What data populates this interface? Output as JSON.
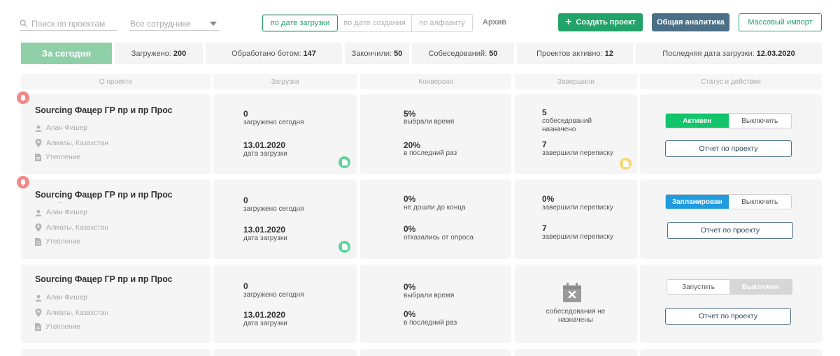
{
  "toolbar": {
    "search_placeholder": "Поиск по проектам",
    "employees_select": "Все сотрудники",
    "sort": [
      "по дате загрузки",
      "по дате создания",
      "по алфавиту"
    ],
    "archive": "Архив",
    "create": "Создать проект",
    "analytics": "Общая аналитика",
    "import": "Массовый импорт"
  },
  "stats": {
    "today": "За сегодня",
    "items": [
      {
        "label": "Загружено:",
        "value": "200"
      },
      {
        "label": "Обработано ботом:",
        "value": "147"
      },
      {
        "label": "Закончили:",
        "value": "50"
      },
      {
        "label": "Собеседований:",
        "value": "50"
      },
      {
        "label": "Проектов активно:",
        "value": "12"
      },
      {
        "label": "Последняя дата загрузки:",
        "value": "12.03.2020"
      }
    ]
  },
  "headers": [
    "О проекте",
    "Загрузки",
    "Конверсия",
    "Завершили",
    "Статус и действия"
  ],
  "rows": [
    {
      "title": "Sourcing Фацер ГР пр и пр Прос",
      "person": "Алан Фишер",
      "location": "Алматы, Казахстан",
      "type": "Утепление",
      "loaded_num": "0",
      "loaded_lbl": "загружено сегодня",
      "date_num": "13.01.2020",
      "date_lbl": "дата загрузки",
      "conv1_num": "5%",
      "conv1_lbl": "выбрали время",
      "conv2_num": "20%",
      "conv2_lbl": "в последний раз",
      "done1_num": "5",
      "done1_lbl": "собеседований назначено",
      "done2_num": "7",
      "done2_lbl": "завершили переписку",
      "toggle_a": "Активен",
      "toggle_b": "Выключить",
      "report": "Отчет по проекту"
    },
    {
      "title": "Sourcing Фацер ГР пр и пр Прос",
      "ellipsis": "...",
      "person": "Алан Фишер",
      "location": "Алматы, Казахстан",
      "type": "Утепление",
      "loaded_num": "0",
      "loaded_lbl": "загружено сегодня",
      "date_num": "13.01.2020",
      "date_lbl": "дата загрузки",
      "conv1_num": "0%",
      "conv1_lbl": "не дошли до конца",
      "conv2_num": "0%",
      "conv2_lbl": "отказались от опроса",
      "done1_num": "0%",
      "done1_lbl": "завершили переписку",
      "done2_num": "7",
      "done2_lbl": "завершили переписку",
      "toggle_a": "Запланирован",
      "toggle_b": "Выключить",
      "report": "Отчет по проекту"
    },
    {
      "title": "Sourcing Фацер ГР пр и пр Прос",
      "person": "Алан Фишер",
      "location": "Алматы, Казахстан",
      "type": "Утепление",
      "loaded_num": "0",
      "loaded_lbl": "загружено сегодня",
      "date_num": "13.01.2020",
      "date_lbl": "дата загрузки",
      "conv1_num": "0%",
      "conv1_lbl": "выбрали время",
      "conv2_num": "0%",
      "conv2_lbl": "в последний раз",
      "no_interviews": "собеседования не назначены",
      "toggle_a": "Запустить",
      "toggle_b": "Выключен",
      "report": "Отчет по проекту"
    }
  ],
  "colors": {
    "green": "#22a36a",
    "active_green": "#12c46a",
    "scheduled_blue": "#1f9be0",
    "slate": "#4b6f86",
    "alert_red": "#f08a8a",
    "badge_yellow": "#f7d774",
    "badge_green": "#5fd39a"
  },
  "icons": [
    "search-icon",
    "chevron-down-icon",
    "plus-icon",
    "bell-icon",
    "person-icon",
    "location-pin-icon",
    "document-icon",
    "file-badge-icon",
    "calendar-cancel-icon"
  ]
}
